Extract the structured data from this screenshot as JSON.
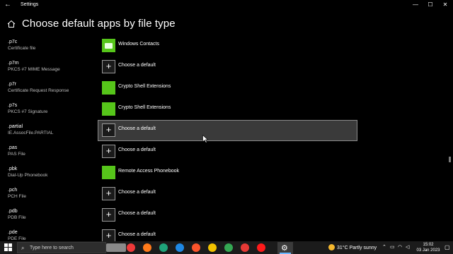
{
  "window": {
    "title": "Settings",
    "back_glyph": "←",
    "minimize_glyph": "—",
    "maximize_glyph": "☐",
    "close_glyph": "✕"
  },
  "page": {
    "title": "Choose default apps by file type"
  },
  "rows": [
    {
      "ext": ".p7c",
      "desc": "Certificate file",
      "app": "Windows Contacts",
      "icon": "contacts-icon",
      "kind": "contacts"
    },
    {
      "ext": ".p7m",
      "desc": "PKCS #7 MIME Message",
      "app": "Choose a default",
      "icon": "plus-icon",
      "kind": "plus"
    },
    {
      "ext": ".p7r",
      "desc": "Certificate Request Response",
      "app": "Crypto Shell Extensions",
      "icon": "crypto-shell-icon",
      "kind": "green"
    },
    {
      "ext": ".p7s",
      "desc": "PKCS #7 Signature",
      "app": "Crypto Shell Extensions",
      "icon": "crypto-shell-icon",
      "kind": "green"
    },
    {
      "ext": ".partial",
      "desc": "IE.AssocFile.PARTIAL",
      "app": "Choose a default",
      "icon": "plus-icon",
      "kind": "plus",
      "selected": true
    },
    {
      "ext": ".pas",
      "desc": "PAS File",
      "app": "Choose a default",
      "icon": "plus-icon",
      "kind": "plus"
    },
    {
      "ext": ".pbk",
      "desc": "Dial-Up Phonebook",
      "app": "Remote Access Phonebook",
      "icon": "phonebook-icon",
      "kind": "green"
    },
    {
      "ext": ".pch",
      "desc": "PCH File",
      "app": "Choose a default",
      "icon": "plus-icon",
      "kind": "plus"
    },
    {
      "ext": ".pdb",
      "desc": "PDB File",
      "app": "Choose a default",
      "icon": "plus-icon",
      "kind": "plus"
    },
    {
      "ext": ".pde",
      "desc": "PDE File",
      "app": "Choose a default",
      "icon": "plus-icon",
      "kind": "plus"
    }
  ],
  "taskbar": {
    "search_placeholder": "Type here to search",
    "weather": "31°C  Partly sunny",
    "time": "15:02",
    "date": "03 Jan 2023",
    "apps": [
      {
        "name": "taskbar-thumbnail-icon",
        "color": "#8a8a8a"
      },
      {
        "name": "vivaldi-icon",
        "color": "#ef3939"
      },
      {
        "name": "firefox-icon",
        "color": "#ff7a1a"
      },
      {
        "name": "edge-dev-icon",
        "color": "#1fa37a"
      },
      {
        "name": "edge-icon",
        "color": "#1e88e5"
      },
      {
        "name": "brave-icon",
        "color": "#fb542b"
      },
      {
        "name": "yellow-browser-icon",
        "color": "#f2c200"
      },
      {
        "name": "chrome-icon",
        "color": "#34a853"
      },
      {
        "name": "red-app-icon",
        "color": "#e53935"
      },
      {
        "name": "youtube-icon",
        "color": "#ff1a1a"
      }
    ]
  },
  "colors": {
    "accent_green": "#56c51a",
    "selected_bg": "#3a3a3a",
    "taskbar_bg": "#1b1b1b"
  }
}
